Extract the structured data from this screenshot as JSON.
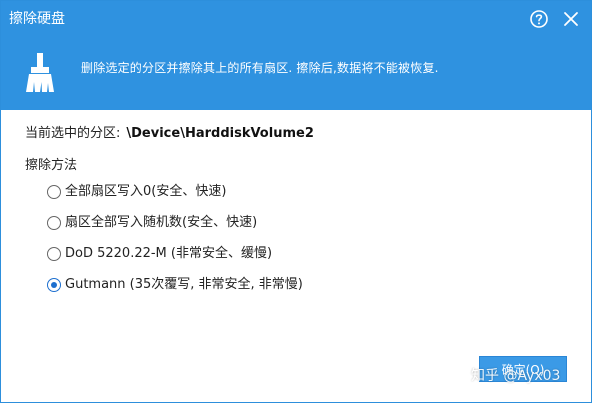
{
  "window": {
    "title": "擦除硬盘"
  },
  "banner": {
    "icon": "broom-icon",
    "message": "删除选定的分区并擦除其上的所有扇区. 擦除后,数据将不能被恢复."
  },
  "partition": {
    "label": "当前选中的分区:",
    "value": "\\Device\\HarddiskVolume2"
  },
  "wipe_method": {
    "label": "擦除方法",
    "options": [
      {
        "label": "全部扇区写入0(安全、快速)",
        "selected": false
      },
      {
        "label": "扇区全部写入随机数(安全、快速)",
        "selected": false
      },
      {
        "label": "DoD 5220.22-M (非常安全、缓慢)",
        "selected": false
      },
      {
        "label": "Gutmann (35次覆写, 非常安全, 非常慢)",
        "selected": true
      }
    ]
  },
  "buttons": {
    "ok_label": "确定(O)"
  },
  "watermark": {
    "text": "知乎 @Ayx03"
  },
  "colors": {
    "titlebar": "#2f92e0",
    "button": "#3b9ae6",
    "radio_selected": "#1d6fcf"
  }
}
